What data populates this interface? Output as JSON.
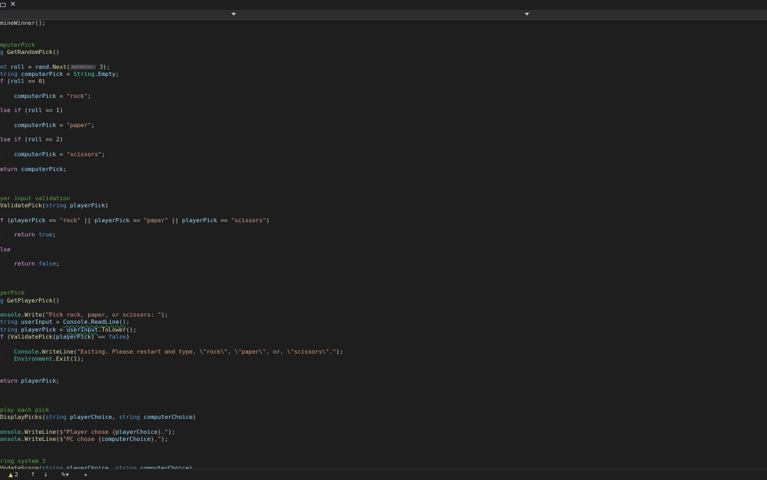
{
  "tabbar": {
    "tab_icon": "pin-icon",
    "close_glyph": "✕"
  },
  "navbar": {
    "dropdowns": [
      "chevron-down-icon",
      "chevron-down-icon"
    ]
  },
  "editor": {
    "lines": [
      [
        [
          "pun",
          "mineWinner();"
        ]
      ],
      [],
      [],
      [
        [
          "cmt",
          "mputerPick"
        ]
      ],
      [
        [
          "kw",
          "g "
        ],
        [
          "mth",
          "GetRandomPick"
        ],
        [
          "pun",
          "()"
        ]
      ],
      [],
      [
        [
          "kw",
          "nt "
        ],
        [
          "var",
          "roll"
        ],
        [
          "pun",
          " = "
        ],
        [
          "var",
          "rand"
        ],
        [
          "pun",
          "."
        ],
        [
          "mth",
          "Next"
        ],
        [
          "pun",
          "("
        ],
        [
          "hint",
          "maxValue:"
        ],
        [
          "pun",
          " "
        ],
        [
          "num",
          "3"
        ],
        [
          "pun",
          ");"
        ]
      ],
      [
        [
          "kw",
          "tring "
        ],
        [
          "var",
          "computerPick"
        ],
        [
          "pun",
          " = "
        ],
        [
          "cls",
          "String"
        ],
        [
          "pun",
          "."
        ],
        [
          "var",
          "Empty"
        ],
        [
          "pun",
          ";"
        ]
      ],
      [
        [
          "ctl",
          "f "
        ],
        [
          "pun",
          "("
        ],
        [
          "var",
          "roll"
        ],
        [
          "pun",
          " == "
        ],
        [
          "num",
          "0"
        ],
        [
          "pun",
          ")"
        ]
      ],
      [],
      [
        [
          "ws",
          "· · "
        ],
        [
          "var",
          "computerPick"
        ],
        [
          "pun",
          " = "
        ],
        [
          "str",
          "\"rock\""
        ],
        [
          "pun",
          ";"
        ]
      ],
      [],
      [
        [
          "ctl",
          "lse if "
        ],
        [
          "pun",
          "("
        ],
        [
          "var",
          "roll"
        ],
        [
          "pun",
          " == "
        ],
        [
          "num",
          "1"
        ],
        [
          "pun",
          ")"
        ]
      ],
      [],
      [
        [
          "ws",
          "· · "
        ],
        [
          "var",
          "computerPick"
        ],
        [
          "pun",
          " = "
        ],
        [
          "str",
          "\"paper\""
        ],
        [
          "pun",
          ";"
        ]
      ],
      [],
      [
        [
          "ctl",
          "lse if "
        ],
        [
          "pun",
          "("
        ],
        [
          "var",
          "roll"
        ],
        [
          "pun",
          " == "
        ],
        [
          "num",
          "2"
        ],
        [
          "pun",
          ")"
        ]
      ],
      [],
      [
        [
          "ws",
          "· · "
        ],
        [
          "var",
          "computerPick"
        ],
        [
          "pun",
          " = "
        ],
        [
          "str",
          "\"scissors\""
        ],
        [
          "pun",
          ";"
        ]
      ],
      [],
      [
        [
          "ctl",
          "eturn "
        ],
        [
          "var",
          "computerPick"
        ],
        [
          "pun",
          ";"
        ]
      ],
      [],
      [],
      [],
      [
        [
          "cmt",
          "yer input validation"
        ]
      ],
      [
        [
          "mth",
          "ValidatePick"
        ],
        [
          "pun",
          "("
        ],
        [
          "kw",
          "string "
        ],
        [
          "var",
          "playerPick"
        ],
        [
          "pun",
          ")"
        ]
      ],
      [],
      [
        [
          "ctl",
          "f "
        ],
        [
          "pun",
          "("
        ],
        [
          "var",
          "playerPick"
        ],
        [
          "pun",
          " == "
        ],
        [
          "str",
          "\"rock\""
        ],
        [
          "pun",
          " || "
        ],
        [
          "var",
          "playerPick"
        ],
        [
          "pun",
          " == "
        ],
        [
          "str",
          "\"paper\""
        ],
        [
          "pun",
          " || "
        ],
        [
          "var",
          "playerPick"
        ],
        [
          "pun",
          " == "
        ],
        [
          "str",
          "\"scissors\""
        ],
        [
          "pun",
          ")"
        ]
      ],
      [],
      [
        [
          "ws",
          "· · "
        ],
        [
          "ctl",
          "return "
        ],
        [
          "kw",
          "true"
        ],
        [
          "pun",
          ";"
        ]
      ],
      [],
      [
        [
          "ctl",
          "lse"
        ]
      ],
      [],
      [
        [
          "ws",
          "· · "
        ],
        [
          "ctl",
          "return "
        ],
        [
          "kw",
          "false"
        ],
        [
          "pun",
          ";"
        ]
      ],
      [],
      [],
      [],
      [
        [
          "cmt",
          "yerPick"
        ]
      ],
      [
        [
          "kw",
          "g "
        ],
        [
          "mth",
          "GetPlayerPick"
        ],
        [
          "pun",
          "()"
        ]
      ],
      [],
      [
        [
          "cls",
          "onsole"
        ],
        [
          "pun",
          "."
        ],
        [
          "mth",
          "Write"
        ],
        [
          "pun",
          "("
        ],
        [
          "str",
          "\"Pick rock, paper, or scissors: \""
        ],
        [
          "pun",
          ");"
        ]
      ],
      [
        [
          "kw",
          "tring "
        ],
        [
          "var",
          "userInput"
        ],
        [
          "pun",
          " = "
        ],
        [
          "sq",
          "Console.ReadLine()"
        ],
        [
          "pun",
          ";"
        ]
      ],
      [
        [
          "kw",
          "tring "
        ],
        [
          "var",
          "playerPick"
        ],
        [
          "pun",
          " = "
        ],
        [
          "sq",
          "userInput"
        ],
        [
          "pun",
          "."
        ],
        [
          "mth",
          "ToLower"
        ],
        [
          "pun",
          "();"
        ]
      ],
      [
        [
          "ctl",
          "f "
        ],
        [
          "pun",
          "("
        ],
        [
          "mth",
          "ValidatePick"
        ],
        [
          "pun",
          "("
        ],
        [
          "var",
          "playerPick"
        ],
        [
          "pun",
          ") == "
        ],
        [
          "kw",
          "false"
        ],
        [
          "pun",
          ")"
        ]
      ],
      [],
      [
        [
          "ws",
          "· · "
        ],
        [
          "cls",
          "Console"
        ],
        [
          "pun",
          "."
        ],
        [
          "mth",
          "WriteLine"
        ],
        [
          "pun",
          "("
        ],
        [
          "str",
          "\"Exiting. Please restart and type, \\\"rock\\\", \\\"paper\\\", or, \\\"scissors\\\".\""
        ],
        [
          "pun",
          ");"
        ]
      ],
      [
        [
          "ws",
          "· · "
        ],
        [
          "cls",
          "Environment"
        ],
        [
          "pun",
          "."
        ],
        [
          "mth",
          "Exit"
        ],
        [
          "pun",
          "("
        ],
        [
          "num",
          "1"
        ],
        [
          "pun",
          ");"
        ]
      ],
      [],
      [],
      [
        [
          "ctl",
          "eturn "
        ],
        [
          "var",
          "playerPick"
        ],
        [
          "pun",
          ";"
        ]
      ],
      [],
      [],
      [],
      [
        [
          "cmt",
          "play each pick"
        ]
      ],
      [
        [
          "mth",
          "DisplayPicks"
        ],
        [
          "pun",
          "("
        ],
        [
          "kw",
          "string "
        ],
        [
          "var",
          "playerChoice"
        ],
        [
          "pun",
          ", "
        ],
        [
          "kw",
          "string "
        ],
        [
          "var",
          "computerChoice"
        ],
        [
          "pun",
          ")"
        ]
      ],
      [],
      [
        [
          "cls",
          "onsole"
        ],
        [
          "pun",
          "."
        ],
        [
          "mth",
          "WriteLine"
        ],
        [
          "pun",
          "("
        ],
        [
          "str",
          "$\"Player chose {"
        ],
        [
          "var",
          "playerChoice"
        ],
        [
          "str",
          "}.\""
        ],
        [
          "pun",
          ");"
        ]
      ],
      [
        [
          "cls",
          "onsole"
        ],
        [
          "pun",
          "."
        ],
        [
          "mth",
          "WriteLine"
        ],
        [
          "pun",
          "("
        ],
        [
          "str",
          "$\"PC chose {"
        ],
        [
          "var",
          "computerChoice"
        ],
        [
          "str",
          "}.\""
        ],
        [
          "pun",
          ");"
        ]
      ],
      [],
      [],
      [
        [
          "cmt",
          "ring system 3"
        ]
      ],
      [
        [
          "mth",
          "UpdateScore"
        ],
        [
          "pun",
          "("
        ],
        [
          "kw",
          "string "
        ],
        [
          "var",
          "playerChoice"
        ],
        [
          "pun",
          ", "
        ],
        [
          "kw",
          "string "
        ],
        [
          "var",
          "computerChoice"
        ],
        [
          "pun",
          ")"
        ]
      ]
    ]
  },
  "statusbar": {
    "warning_count": "2",
    "warning_icon": "warning-icon",
    "up_arrow": "↑",
    "down_arrow": "↓",
    "brush_glyph": "✎▾",
    "scroll_left": "◂"
  },
  "colors": {
    "background": "#1e1e1e",
    "keyword": "#569cd6",
    "control": "#d8a0df",
    "type": "#4ec9b0",
    "method": "#dcdcaa",
    "variable": "#9cdcfe",
    "string": "#d69d85",
    "number": "#b5cea8",
    "comment": "#57a64a"
  }
}
